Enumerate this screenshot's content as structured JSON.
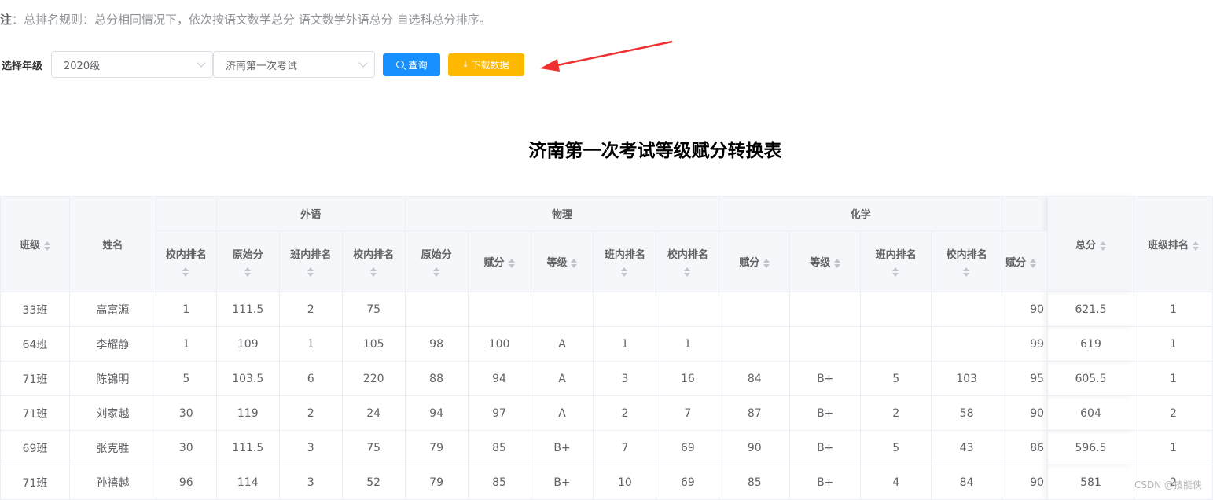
{
  "note": {
    "prefix": "注",
    "text": "：总排名规则：总分相同情况下，依次按语文数学总分 语文数学外语总分 自选科总分排序。"
  },
  "filter": {
    "label": "选择年级",
    "grade": "2020级",
    "exam": "济南第一次考试",
    "query_label": "查询",
    "download_label": "下载数据"
  },
  "title": "济南第一次考试等级赋分转换表",
  "headers": {
    "class": "班级",
    "name": "姓名",
    "group_foreign": "外语",
    "group_physics": "物理",
    "group_chem": "化学",
    "school_rank": "校内排名",
    "raw_score": "原始分",
    "class_rank": "班内排名",
    "scaled_score": "赋分",
    "grade_level": "等级",
    "total": "总分",
    "class_total_rank": "班级排名"
  },
  "rows": [
    {
      "class": "33班",
      "name": "高富源",
      "c1": "1",
      "c2": "111.5",
      "c3": "2",
      "c4": "75",
      "c5": "",
      "c6": "",
      "c7": "",
      "c8": "",
      "c9": "",
      "c10": "",
      "c11": "",
      "c12": "",
      "c13": "",
      "c14": "90",
      "total": "621.5",
      "rank": "1"
    },
    {
      "class": "64班",
      "name": "李耀静",
      "c1": "1",
      "c2": "109",
      "c3": "1",
      "c4": "105",
      "c5": "98",
      "c6": "100",
      "c7": "A",
      "c8": "1",
      "c9": "1",
      "c10": "",
      "c11": "",
      "c12": "",
      "c13": "",
      "c14": "99",
      "total": "619",
      "rank": "1"
    },
    {
      "class": "71班",
      "name": "陈锦明",
      "c1": "5",
      "c2": "103.5",
      "c3": "6",
      "c4": "220",
      "c5": "88",
      "c6": "94",
      "c7": "A",
      "c8": "3",
      "c9": "16",
      "c10": "84",
      "c11": "B+",
      "c12": "5",
      "c13": "103",
      "c14": "95",
      "total": "605.5",
      "rank": "1"
    },
    {
      "class": "71班",
      "name": "刘家越",
      "c1": "30",
      "c2": "119",
      "c3": "2",
      "c4": "24",
      "c5": "94",
      "c6": "97",
      "c7": "A",
      "c8": "2",
      "c9": "7",
      "c10": "87",
      "c11": "B+",
      "c12": "2",
      "c13": "58",
      "c14": "90",
      "total": "604",
      "rank": "2"
    },
    {
      "class": "69班",
      "name": "张克胜",
      "c1": "30",
      "c2": "111.5",
      "c3": "3",
      "c4": "75",
      "c5": "79",
      "c6": "85",
      "c7": "B+",
      "c8": "7",
      "c9": "69",
      "c10": "90",
      "c11": "B+",
      "c12": "5",
      "c13": "43",
      "c14": "86",
      "total": "596.5",
      "rank": "1"
    },
    {
      "class": "71班",
      "name": "孙禧越",
      "c1": "96",
      "c2": "114",
      "c3": "3",
      "c4": "52",
      "c5": "79",
      "c6": "85",
      "c7": "B+",
      "c8": "10",
      "c9": "69",
      "c10": "85",
      "c11": "B+",
      "c12": "4",
      "c13": "84",
      "c14": "90",
      "total": "581",
      "rank": "2"
    }
  ],
  "watermark": "CSDN @技能侠"
}
